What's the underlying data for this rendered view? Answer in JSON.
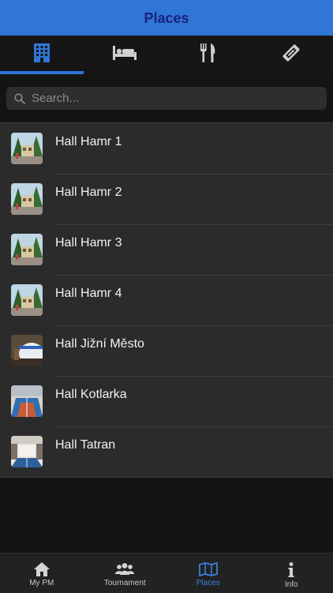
{
  "header": {
    "title": "Places"
  },
  "category_tabs": [
    {
      "icon": "building-icon",
      "active": true
    },
    {
      "icon": "bed-icon",
      "active": false
    },
    {
      "icon": "fork-knife-icon",
      "active": false
    },
    {
      "icon": "ticket-icon",
      "active": false
    }
  ],
  "search": {
    "placeholder": "Search...",
    "value": ""
  },
  "places": [
    {
      "name": "Hall Hamr 1",
      "thumb": "trees"
    },
    {
      "name": "Hall Hamr 2",
      "thumb": "trees"
    },
    {
      "name": "Hall Hamr 3",
      "thumb": "trees"
    },
    {
      "name": "Hall Hamr 4",
      "thumb": "trees"
    },
    {
      "name": "Hall Jižní Město",
      "thumb": "dome"
    },
    {
      "name": "Hall Kotlarka",
      "thumb": "court"
    },
    {
      "name": "Hall Tatran",
      "thumb": "hall"
    }
  ],
  "bottom_nav": [
    {
      "label": "My PM",
      "icon": "home-icon",
      "active": false
    },
    {
      "label": "Tournament",
      "icon": "group-icon",
      "active": false
    },
    {
      "label": "Places",
      "icon": "map-icon",
      "active": true
    },
    {
      "label": "Info",
      "icon": "info-icon",
      "active": false
    }
  ],
  "colors": {
    "accent": "#2f76d6",
    "header_title": "#1a237e",
    "background": "#141414",
    "list_bg": "#2b2b2b",
    "active_nav": "#3a7fe0"
  }
}
